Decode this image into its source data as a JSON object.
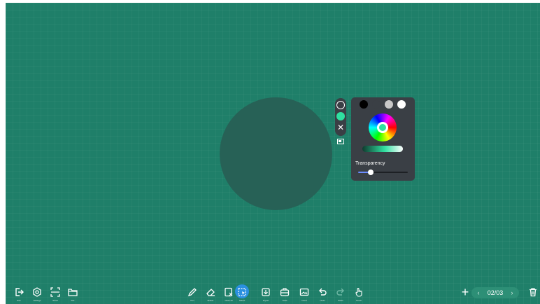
{
  "board": {
    "background_color": "#1f7f69",
    "shape_color": "#276156"
  },
  "color_panel": {
    "swatches": [
      "#000000",
      "#3a3f45",
      "#c8c8c8",
      "#ffffff"
    ],
    "selected_color": "#2fe0a0",
    "transparency_label": "Transparency",
    "transparency_value": 0.25
  },
  "shape_strip": {
    "items": [
      "circle-outline-icon",
      "circle-fill-icon",
      "close-icon"
    ],
    "close_glyph": "✕"
  },
  "left_toolbar": {
    "items": [
      {
        "icon": "exit-icon",
        "label": "Exit"
      },
      {
        "icon": "settings-icon",
        "label": "Settings"
      },
      {
        "icon": "screenshot-icon",
        "label": "Shoot"
      },
      {
        "icon": "folder-icon",
        "label": "File"
      }
    ]
  },
  "center_toolbar": {
    "items": [
      {
        "icon": "pen-icon",
        "label": "Pen"
      },
      {
        "icon": "eraser-icon",
        "label": "Eraser"
      },
      {
        "icon": "clear-page-icon",
        "label": "Clear all"
      },
      {
        "icon": "select-icon",
        "label": "Select"
      },
      {
        "icon": "import-icon",
        "label": "Import"
      },
      {
        "icon": "tools-icon",
        "label": "Tools"
      },
      {
        "icon": "insert-icon",
        "label": "Insert"
      },
      {
        "icon": "undo-icon",
        "label": "Undo"
      },
      {
        "icon": "redo-icon",
        "label": "Redo"
      },
      {
        "icon": "touch-icon",
        "label": "Touch"
      }
    ]
  },
  "pager": {
    "add_glyph": "+",
    "prev_glyph": "‹",
    "next_glyph": "›",
    "page_text": "02/03",
    "delete_icon": "trash-icon"
  },
  "accent_color": "#2a90e0"
}
